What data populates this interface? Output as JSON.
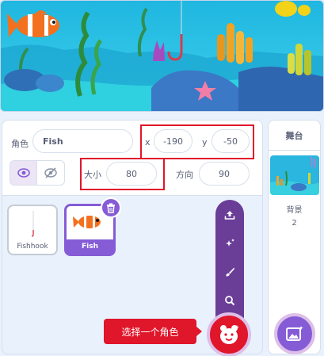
{
  "sprite_info": {
    "sprite_label": "角色",
    "sprite_name": "Fish",
    "x_label": "x",
    "x_value": "-190",
    "y_label": "y",
    "y_value": "-50",
    "size_label": "大小",
    "size_value": "80",
    "direction_label": "方向",
    "direction_value": "90"
  },
  "sprites": [
    {
      "name": "Fishhook"
    },
    {
      "name": "Fish"
    }
  ],
  "add_menu": {
    "tooltip": "选择一个角色",
    "items": [
      "upload-icon",
      "surprise-icon",
      "paint-icon",
      "search-icon"
    ]
  },
  "stage_pane": {
    "title": "舞台",
    "backdrop_label": "背景",
    "backdrop_count": "2"
  },
  "colors": {
    "accent_purple": "#855cd6",
    "highlight_red": "#e0162b",
    "menu_purple": "#6a3d97"
  }
}
